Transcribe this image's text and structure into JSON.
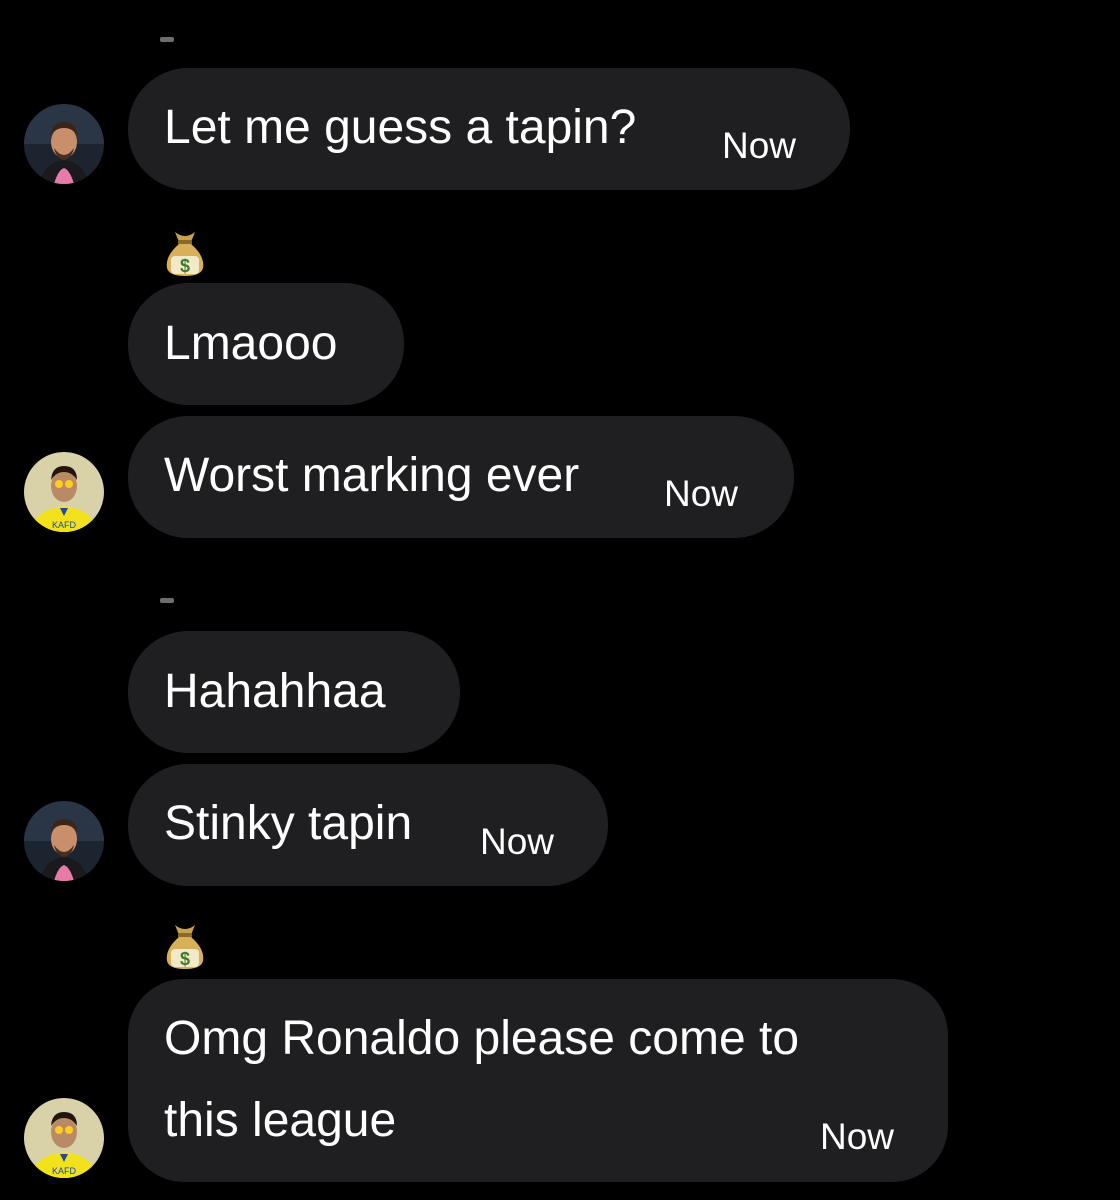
{
  "conversation": {
    "messages": [
      {
        "text": "Let me guess a tapin?",
        "time": "Now",
        "sender": "messi"
      },
      {
        "text": "Lmaooo",
        "time": "",
        "sender": "ronaldo",
        "reaction_above": "money-bag"
      },
      {
        "text": "Worst marking ever",
        "time": "Now",
        "sender": "ronaldo"
      },
      {
        "text": "Hahahhaa",
        "time": "",
        "sender": "messi"
      },
      {
        "text": "Stinky tapin",
        "time": "Now",
        "sender": "messi"
      },
      {
        "text_line1": "Omg Ronaldo please come to",
        "text_line2": "this league",
        "time": "Now",
        "sender": "ronaldo",
        "reaction_above": "money-bag"
      }
    ]
  },
  "icons": {
    "reaction": "money-bag-icon",
    "avatar_1": "messi-avatar",
    "avatar_2": "ronaldo-avatar"
  },
  "colors": {
    "background": "#000000",
    "bubble": "#1f1f22",
    "text": "#ffffff",
    "ronaldo_kit": "#f2e21c"
  }
}
